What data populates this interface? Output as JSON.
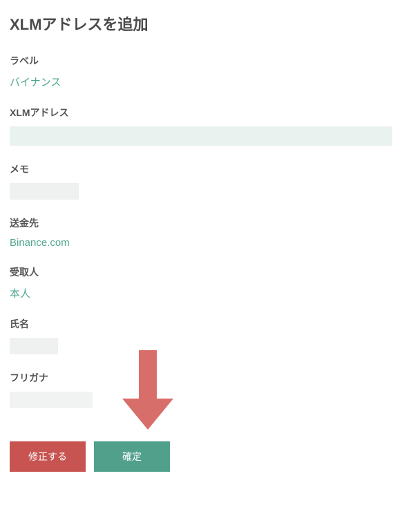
{
  "title": "XLMアドレスを追加",
  "fields": {
    "label": {
      "title": "ラベル",
      "value": "バイナンス"
    },
    "address": {
      "title": "XLMアドレス"
    },
    "memo": {
      "title": "メモ"
    },
    "destination": {
      "title": "送金先",
      "value": "Binance.com"
    },
    "recipient": {
      "title": "受取人",
      "value": "本人"
    },
    "name": {
      "title": "氏名"
    },
    "furigana": {
      "title": "フリガナ"
    }
  },
  "buttons": {
    "edit": "修正する",
    "confirm": "確定"
  }
}
